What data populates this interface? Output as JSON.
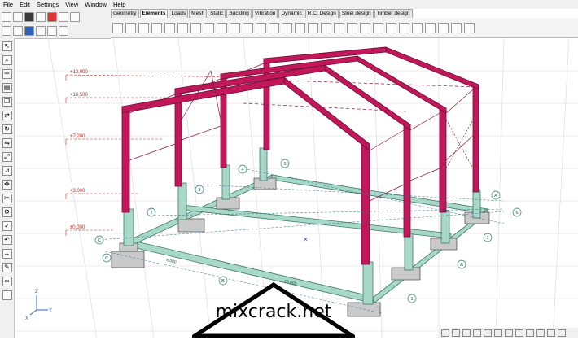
{
  "menu": [
    "File",
    "Edit",
    "Settings",
    "View",
    "Window",
    "Help"
  ],
  "tabs": [
    "Geometry",
    "Elements",
    "Loads",
    "Mesh",
    "Static",
    "Buckling",
    "Vibration",
    "Dynamic",
    "R.C. Design",
    "Steel design",
    "Timber design"
  ],
  "active_tab": "Elements",
  "levels": [
    "+12,000",
    "+10,500",
    "+7,200",
    "+3,000",
    "±0,000"
  ],
  "grid_labels": {
    "axis_A": "A",
    "axis_B": "B",
    "axis_C": "C",
    "axis_1": "1",
    "axis_2": "2",
    "axis_3": "3",
    "axis_4": "4",
    "axis_5": "5",
    "axis_6": "6",
    "axis_7": "7"
  },
  "dimensions": [
    "6,000",
    "10,000"
  ],
  "axes_labels": {
    "x": "X",
    "y": "Y",
    "z": "Z"
  },
  "watermark": "mixcrack.net",
  "colors": {
    "frame": "#c2185b",
    "concrete": "#a8d8c8",
    "footing": "#c9c9c9",
    "grid": "#d8d8d8",
    "level": "#d02020"
  }
}
